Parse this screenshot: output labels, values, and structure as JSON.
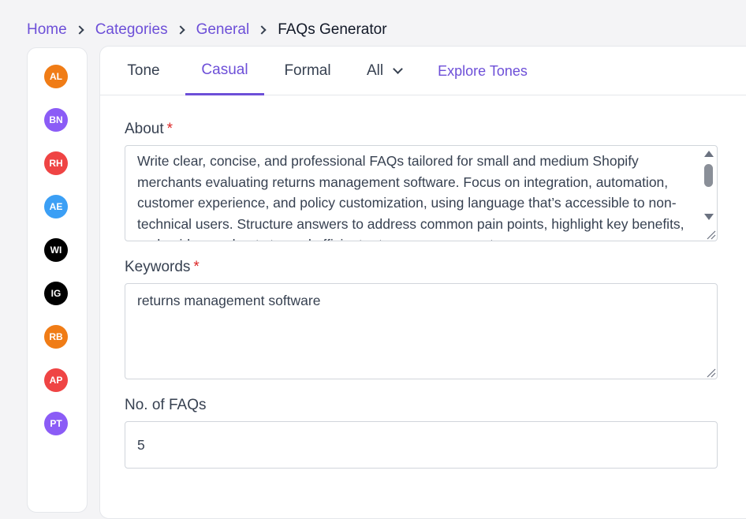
{
  "breadcrumb": {
    "home": "Home",
    "categories": "Categories",
    "general": "General",
    "current": "FAQs Generator"
  },
  "avatars": [
    {
      "initials": "AL",
      "color": "#f07c16"
    },
    {
      "initials": "BN",
      "color": "#8b5cf6"
    },
    {
      "initials": "RH",
      "color": "#ef4444"
    },
    {
      "initials": "AE",
      "color": "#3b9ff5"
    },
    {
      "initials": "WI",
      "color": "#000000"
    },
    {
      "initials": "IG",
      "color": "#000000"
    },
    {
      "initials": "RB",
      "color": "#f07c16"
    },
    {
      "initials": "AP",
      "color": "#ef4444"
    },
    {
      "initials": "PT",
      "color": "#8b5cf6"
    }
  ],
  "tabs": {
    "tone": "Tone",
    "casual": "Casual",
    "formal": "Formal",
    "all": "All",
    "explore": "Explore Tones",
    "active": "casual"
  },
  "form": {
    "about_label": "About",
    "required_mark": "*",
    "about_value": "Write clear, concise, and professional FAQs tailored for small and medium Shopify merchants evaluating returns management software. Focus on integration, automation, customer experience, and policy customization, using language that’s accessible to non-technical users. Structure answers to address common pain points, highlight key benefits, and guide merchants toward efficient returns management.",
    "keywords_label": "Keywords",
    "keywords_value": "returns management software",
    "num_label": "No. of FAQs",
    "num_value": "5"
  },
  "colors": {
    "accent": "#6d4fd8",
    "required": "#dc2626"
  }
}
